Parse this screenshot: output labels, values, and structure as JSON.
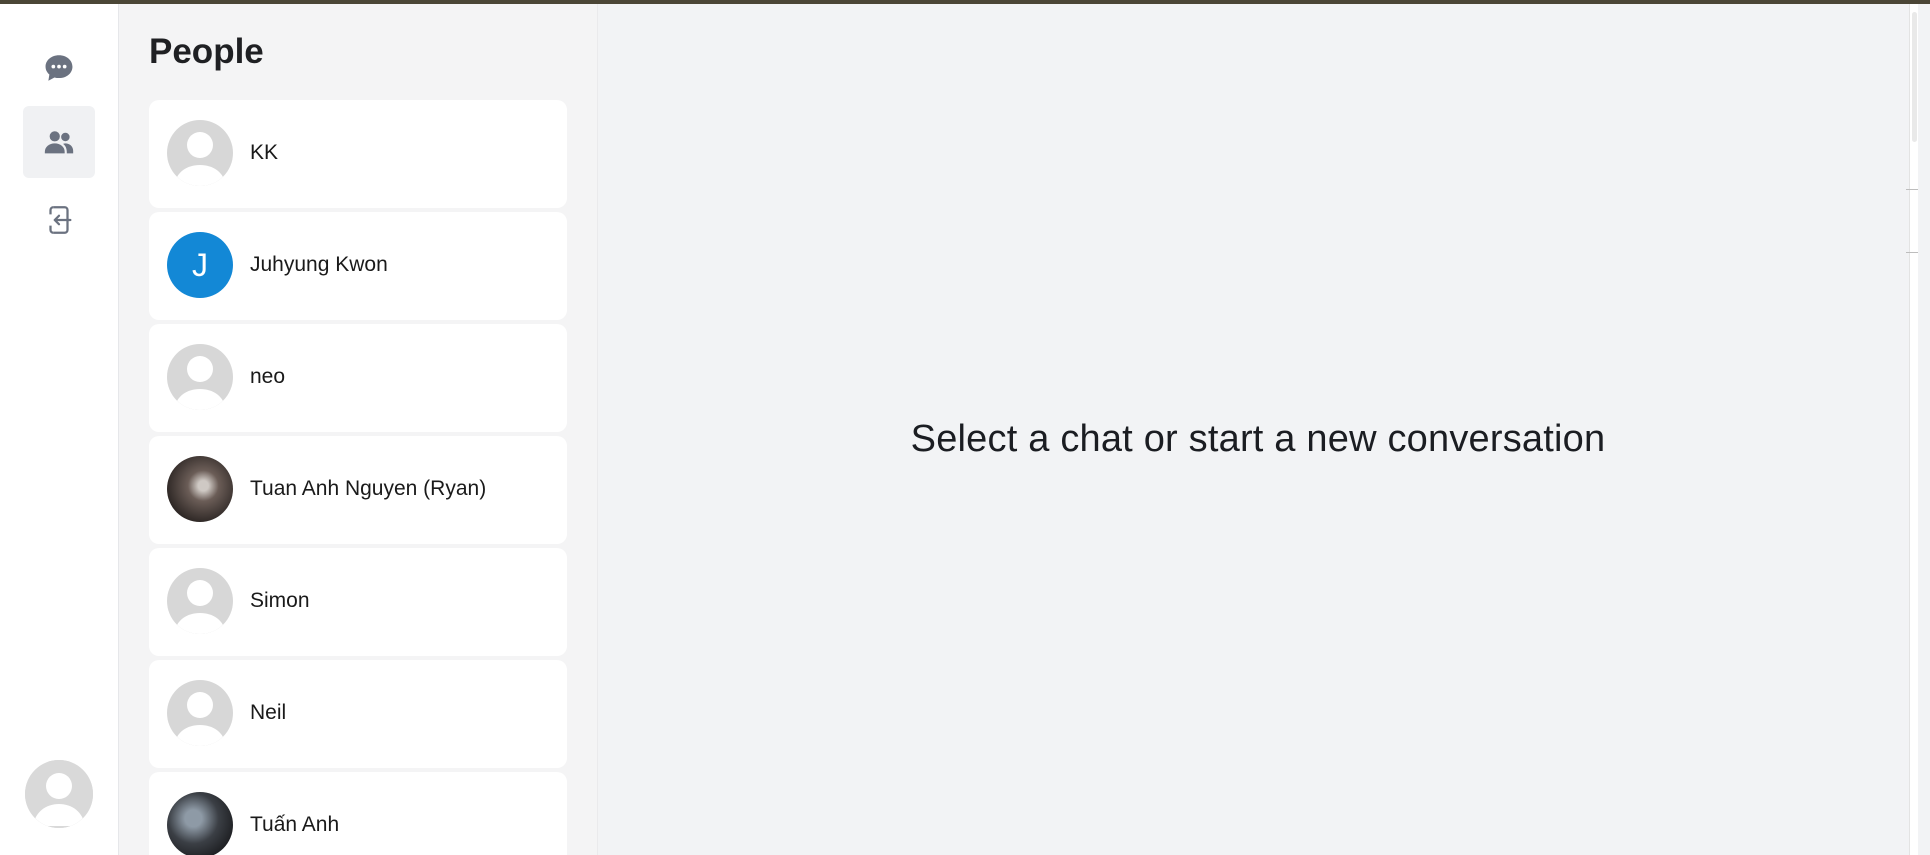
{
  "rail": {
    "items": [
      {
        "icon": "chat-bubble-icon",
        "active": false
      },
      {
        "icon": "people-icon",
        "active": true
      },
      {
        "icon": "logout-icon",
        "active": false
      }
    ],
    "current_user_icon": "avatar-placeholder-icon"
  },
  "people": {
    "title": "People",
    "contacts": [
      {
        "name": "KK",
        "avatar": "default"
      },
      {
        "name": "Juhyung Kwon",
        "avatar": "letter",
        "initial": "J",
        "color": "#1388d6"
      },
      {
        "name": "neo",
        "avatar": "default"
      },
      {
        "name": "Tuan Anh Nguyen (Ryan)",
        "avatar": "photo"
      },
      {
        "name": "Simon",
        "avatar": "default"
      },
      {
        "name": "Neil",
        "avatar": "default"
      },
      {
        "name": "Tuấn Anh",
        "avatar": "photo"
      }
    ]
  },
  "main": {
    "empty_message": "Select a chat or start a new conversation"
  },
  "colors": {
    "accent": "#1388d6",
    "background": "#f2f3f5",
    "card": "#ffffff"
  }
}
